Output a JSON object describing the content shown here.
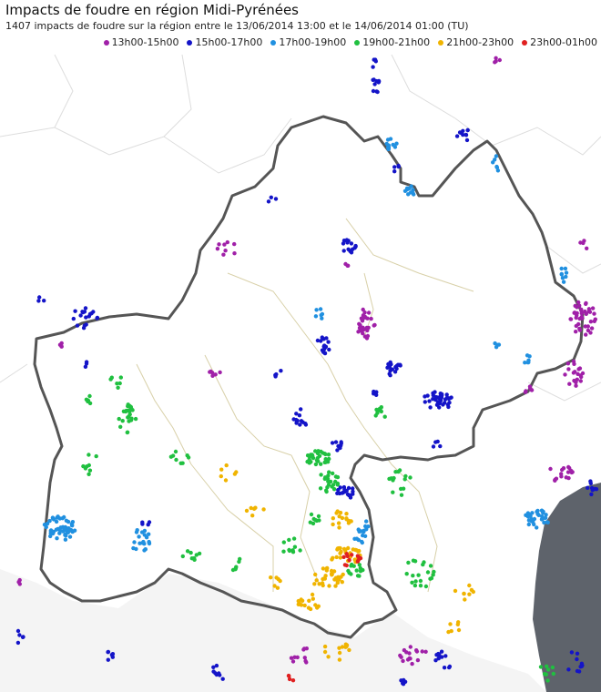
{
  "title": "Impacts de foudre en région Midi-Pyrénées",
  "subtitle": "1407 impacts de foudre sur la région entre le 13/06/2014 13:00 et le 14/06/2014 01:00 (TU)",
  "legend": [
    {
      "label": "13h00-15h00",
      "color": "#a020a8"
    },
    {
      "label": "15h00-17h00",
      "color": "#1414c8"
    },
    {
      "label": "17h00-19h00",
      "color": "#2090e0"
    },
    {
      "label": "19h00-21h00",
      "color": "#20c040"
    },
    {
      "label": "21h00-23h00",
      "color": "#f0b400"
    },
    {
      "label": "23h00-01h00",
      "color": "#e02020"
    }
  ],
  "colors": {
    "sea": "#5e636b",
    "spain": "#f4f4f4",
    "region_border": "#555555",
    "department_border": "#d8d0a8"
  }
}
